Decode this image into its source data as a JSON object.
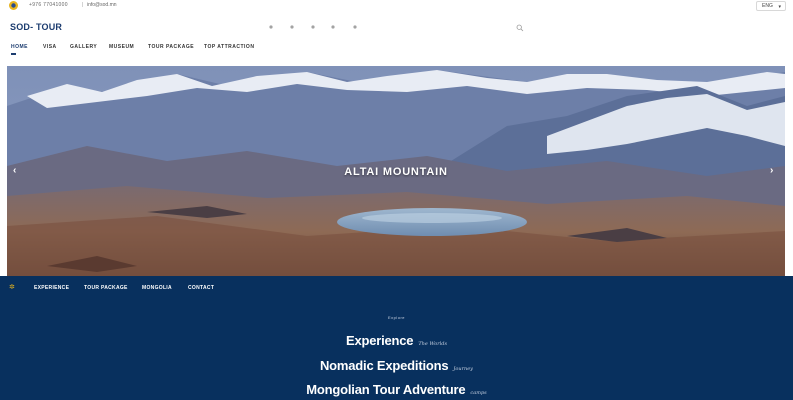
{
  "topbar": {
    "phone": "+976 77041000",
    "separator": "|",
    "email": "info@sod.mn",
    "language": "ENG"
  },
  "brand": {
    "name": "SOD- TOUR"
  },
  "social_icons": [
    "facebook-icon",
    "twitter-icon",
    "instagram-icon",
    "youtube-icon",
    "tripadvisor-icon"
  ],
  "nav": {
    "items": [
      {
        "label": "Home",
        "active": true
      },
      {
        "label": "Visa"
      },
      {
        "label": "Gallery"
      },
      {
        "label": "Museum"
      },
      {
        "label": "Tour Package"
      },
      {
        "label": "Top Attraction"
      }
    ]
  },
  "hero": {
    "title": "ALTAI MOUNTAIN",
    "prev_glyph": "‹",
    "next_glyph": "›"
  },
  "sub_nav": {
    "items": [
      {
        "label": "Experience"
      },
      {
        "label": "Tour Package"
      },
      {
        "label": "Mongolia"
      },
      {
        "label": "Contact"
      }
    ]
  },
  "navy": {
    "label": "Explore",
    "headlines": [
      {
        "big": "Experience",
        "small": "The Worlds"
      },
      {
        "big": "Nomadic Expeditions",
        "small": "Journey"
      },
      {
        "big": "Mongolian Tour Adventure",
        "small": "camps"
      }
    ]
  },
  "colors": {
    "navy": "#08305e",
    "brand": "#1c3c6f",
    "accent": "#e0b020"
  }
}
